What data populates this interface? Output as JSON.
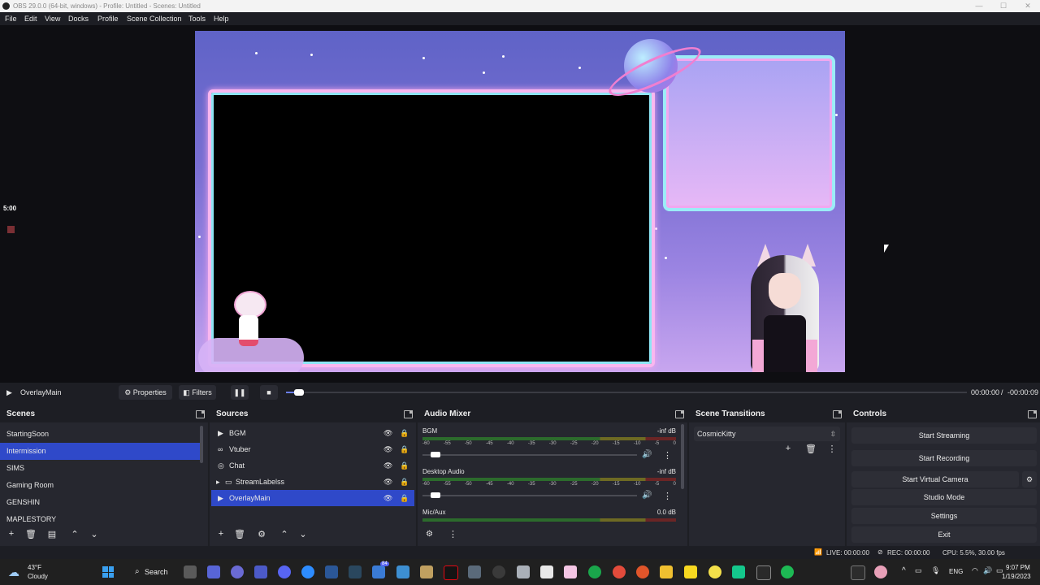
{
  "titlebar": {
    "title": "OBS 29.0.0 (64-bit, windows) - Profile: Untitled - Scenes: Untitled",
    "min": "—",
    "max": "☐",
    "close": "✕"
  },
  "menu": [
    "File",
    "Edit",
    "View",
    "Docks",
    "Profile",
    "Scene Collection",
    "Tools",
    "Help"
  ],
  "side": {
    "clock": "5:00"
  },
  "mediabar": {
    "play": "▶",
    "source": "OverlayMain",
    "properties": "Properties",
    "filters": "Filters",
    "pause": "❚❚",
    "stop": "■",
    "time": "00:00:00",
    "sep": "/",
    "remaining": "-00:00:09"
  },
  "scenes": {
    "title": "Scenes",
    "items": [
      "StartingSoon",
      "Intermission",
      "SIMS",
      "Gaming Room",
      "GENSHIN",
      "MAPLESTORY"
    ],
    "selected": 1,
    "toolbar": [
      "+",
      "🗑",
      "▤",
      "⌃",
      "⌄"
    ]
  },
  "sources": {
    "title": "Sources",
    "items": [
      {
        "name": "BGM",
        "icon": "▶"
      },
      {
        "name": "Vtuber",
        "icon": "∞"
      },
      {
        "name": "Chat",
        "icon": "◎"
      },
      {
        "name": "StreamLabelss",
        "icon": "▸"
      },
      {
        "name": "OverlayMain",
        "icon": "▶"
      }
    ],
    "selected": 4,
    "eye": "👁",
    "lock": "🔒",
    "toolbar": [
      "+",
      "🗑",
      "⚙",
      "⌃",
      "⌄"
    ]
  },
  "mixer": {
    "title": "Audio Mixer",
    "scale": [
      "-60",
      "-55",
      "-50",
      "-45",
      "-40",
      "-35",
      "-30",
      "-25",
      "-20",
      "-15",
      "-10",
      "-5",
      "0"
    ],
    "channels": [
      {
        "name": "BGM",
        "db": "-inf dB",
        "volume": 0.04
      },
      {
        "name": "Desktop Audio",
        "db": "-inf dB",
        "volume": 0.04
      },
      {
        "name": "Mic/Aux",
        "db": "0.0 dB",
        "volume": 1
      }
    ],
    "speaker": "🔊",
    "menu": "⋮"
  },
  "transitions": {
    "title": "Scene Transitions",
    "selected": "CosmicKitty",
    "toolbar": [
      "+",
      "🗑",
      "⋮"
    ]
  },
  "controls": {
    "title": "Controls",
    "buttons": [
      "Start Streaming",
      "Start Recording",
      "Start Virtual Camera",
      "Studio Mode",
      "Settings",
      "Exit"
    ],
    "gear": "⚙"
  },
  "status": {
    "live": "LIVE: 00:00:00",
    "rec": "REC: 00:00:00",
    "cpu": "CPU: 5.5%, 30.00 fps"
  },
  "taskbar": {
    "weather_temp": "43°F",
    "weather_text": "Cloudy",
    "search": "Search",
    "badge": "84",
    "lang": "ENG",
    "time": "9:07 PM",
    "date": "1/19/2023"
  },
  "colors": {
    "accent": "#2f49c9",
    "panel": "#26272f",
    "bg": "#1d1e24"
  }
}
